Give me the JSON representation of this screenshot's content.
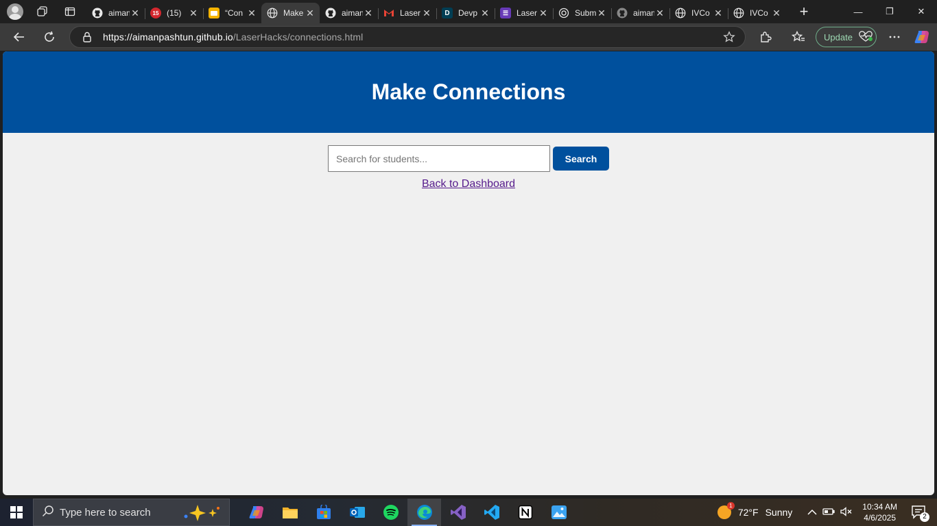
{
  "browser": {
    "tabs": [
      {
        "title": "aiman",
        "favicon": "github-icon"
      },
      {
        "title": "(15)",
        "favicon": "notification-15-icon"
      },
      {
        "title": "“Con",
        "favicon": "slides-icon"
      },
      {
        "title": "Make",
        "favicon": "globe-icon",
        "active": true
      },
      {
        "title": "aiman",
        "favicon": "github-icon"
      },
      {
        "title": "Laser",
        "favicon": "gmail-icon"
      },
      {
        "title": "Devp",
        "favicon": "devpost-icon"
      },
      {
        "title": "Laser",
        "favicon": "forms-icon"
      },
      {
        "title": "Subm",
        "favicon": "openai-icon"
      },
      {
        "title": "aiman",
        "favicon": "github-icon"
      },
      {
        "title": "IVCo",
        "favicon": "globe-icon"
      },
      {
        "title": "IVCo",
        "favicon": "globe-icon"
      }
    ],
    "url_host": "https://aimanpashtun.github.io",
    "url_path": "/LaserHacks/connections.html",
    "update_label": "Update"
  },
  "page": {
    "heading": "Make Connections",
    "search_placeholder": "Search for students...",
    "search_value": "",
    "search_button": "Search",
    "back_link": "Back to Dashboard"
  },
  "taskbar": {
    "search_text": "Type here to search",
    "apps": [
      "copilot-icon",
      "file-explorer-icon",
      "microsoft-store-icon",
      "outlook-icon",
      "spotify-icon",
      "edge-icon",
      "visual-studio-icon",
      "vscode-icon",
      "notion-icon",
      "photos-icon"
    ],
    "weather_badge": "1",
    "temperature": "72°F",
    "weather": "Sunny",
    "time": "10:34 AM",
    "date": "4/6/2025",
    "notification_count": "2"
  },
  "colors": {
    "header_blue": "#00509d",
    "page_background": "#f0f0f0",
    "link_visited": "#551a8b"
  }
}
